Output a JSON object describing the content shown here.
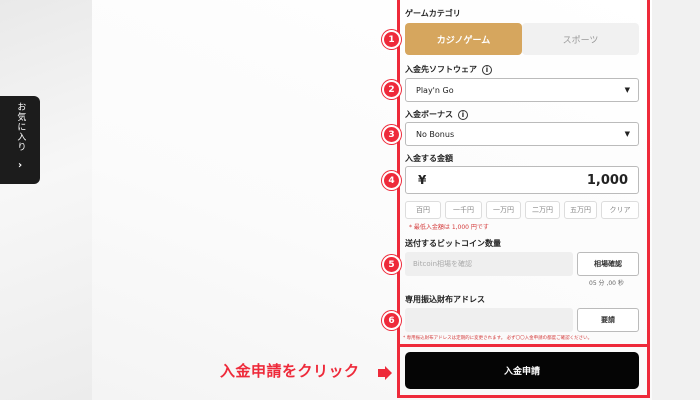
{
  "sidebar_tab": {
    "label": "お気に入り",
    "arrow": "›"
  },
  "form": {
    "game_category": {
      "label": "ゲームカテゴリ",
      "options": [
        "カジノゲーム",
        "スポーツ"
      ],
      "selected": "カジノゲーム"
    },
    "software": {
      "label": "入金先ソフトウェア",
      "value": "Play'n Go"
    },
    "bonus": {
      "label": "入金ボーナス",
      "value": "No Bonus"
    },
    "amount": {
      "label": "入金する金額",
      "currency": "¥",
      "value": "1,000",
      "quick_buttons": [
        "百円",
        "一千円",
        "一万円",
        "二万円",
        "五万円",
        "クリア"
      ],
      "min_note": "* 最低入金額は 1,000 円です"
    },
    "bitcoin": {
      "label": "送付するビットコイン数量",
      "placeholder": "Bitcoin相場を確認",
      "check_button": "相場確認",
      "timer": "05 分 ,00 秒"
    },
    "address": {
      "label": "専用振込財布アドレス",
      "button": "要請",
      "note": "* 専用振込財布アドレスは定期的に変更されます。 必ず〇〇入金申請の都度ご確認ください。"
    },
    "submit_label": "入金申請"
  },
  "annotations": {
    "markers": [
      "1",
      "2",
      "3",
      "4",
      "5",
      "6"
    ],
    "callout": "入金申請をクリック"
  },
  "colors": {
    "accent_red": "#ee2a3a",
    "gold": "#d6a65e",
    "dark": "#050505"
  }
}
